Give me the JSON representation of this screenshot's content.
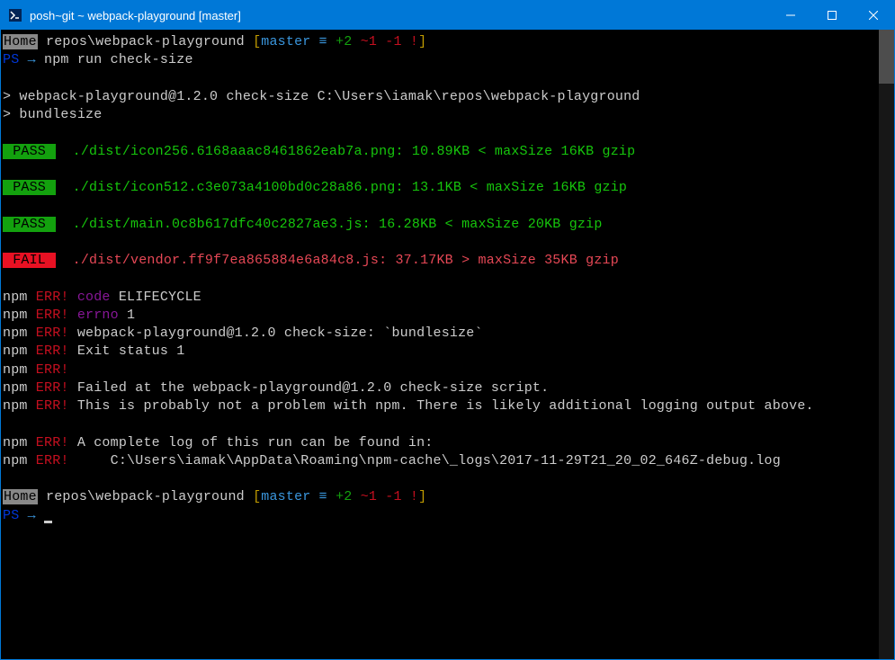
{
  "window": {
    "title": "posh~git ~ webpack-playground [master]"
  },
  "prompt1": {
    "home": "Home",
    "path": " repos\\webpack-playground ",
    "bracket_open": "[",
    "branch": "master",
    "equiv": " ≡ ",
    "plus": "+2",
    "tilde": " ~1",
    "minus": " -1",
    "bang": " !",
    "bracket_close": "]"
  },
  "ps_line": {
    "ps": "PS",
    "arrow": " → ",
    "command": "npm run check-size"
  },
  "npm_header": {
    "line1": "> webpack-playground@1.2.0 check-size C:\\Users\\iamak\\repos\\webpack-playground",
    "line2": "> bundlesize"
  },
  "results": {
    "pass_label": " PASS ",
    "fail_label": " FAIL ",
    "r1": "  ./dist/icon256.6168aaac8461862eab7a.png: 10.89KB < maxSize 16KB gzip",
    "r2": "  ./dist/icon512.c3e073a4100bd0c28a86.png: 13.1KB < maxSize 16KB gzip",
    "r3": "  ./dist/main.0c8b617dfc40c2827ae3.js: 16.28KB < maxSize 20KB gzip",
    "r4": "  ./dist/vendor.ff9f7ea865884e6a84c8.js: 37.17KB > maxSize 35KB gzip"
  },
  "errors": {
    "npm": "npm",
    "err": " ERR!",
    "code_label": " code",
    "code_val": " ELIFECYCLE",
    "errno_label": " errno",
    "errno_val": " 1",
    "l3": " webpack-playground@1.2.0 check-size: `bundlesize`",
    "l4": " Exit status 1",
    "l6": " Failed at the webpack-playground@1.2.0 check-size script.",
    "l7": " This is probably not a problem with npm. There is likely additional logging output above.",
    "l9": " A complete log of this run can be found in:",
    "l10": "     C:\\Users\\iamak\\AppData\\Roaming\\npm-cache\\_logs\\2017-11-29T21_20_02_646Z-debug.log"
  },
  "ps_line2": {
    "ps": "PS",
    "arrow": " → "
  }
}
